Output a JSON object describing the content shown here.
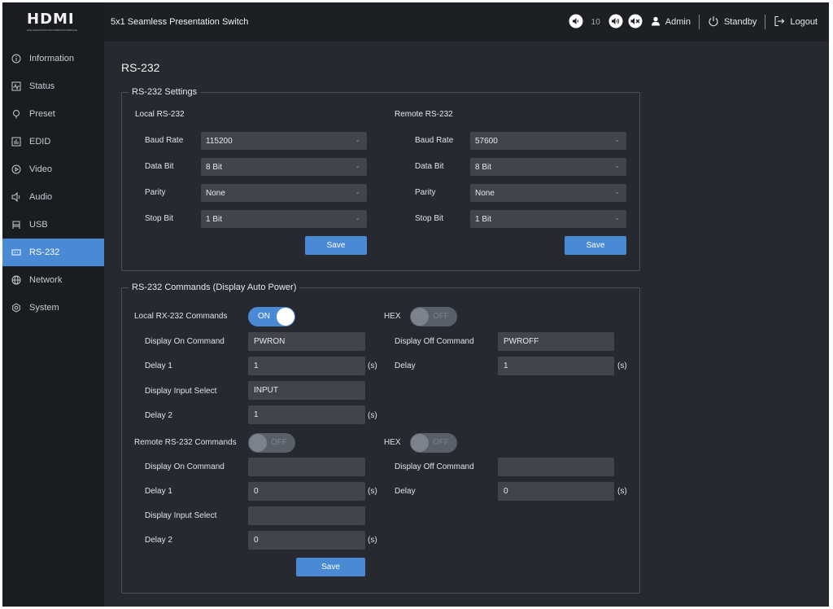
{
  "logo": {
    "text": "HDMI",
    "subtitle": "HIGH-DEFINITION MULTIMEDIA INTERFACE"
  },
  "header": {
    "title": "5x1 Seamless Presentation Switch",
    "volume_value": "10",
    "admin_label": "Admin",
    "standby_label": "Standby",
    "logout_label": "Logout"
  },
  "sidebar": {
    "items": [
      {
        "label": "Information",
        "icon": "info-icon"
      },
      {
        "label": "Status",
        "icon": "status-icon"
      },
      {
        "label": "Preset",
        "icon": "preset-icon"
      },
      {
        "label": "EDID",
        "icon": "edid-icon"
      },
      {
        "label": "Video",
        "icon": "video-icon"
      },
      {
        "label": "Audio",
        "icon": "audio-icon"
      },
      {
        "label": "USB",
        "icon": "usb-icon"
      },
      {
        "label": "RS-232",
        "icon": "rs232-icon",
        "active": true
      },
      {
        "label": "Network",
        "icon": "network-icon"
      },
      {
        "label": "System",
        "icon": "system-icon"
      }
    ]
  },
  "page": {
    "title": "RS-232"
  },
  "settings": {
    "legend": "RS-232 Settings",
    "local": {
      "title": "Local RS-232",
      "baud_label": "Baud Rate",
      "baud_value": "115200",
      "data_label": "Data Bit",
      "data_value": "8 Bit",
      "parity_label": "Parity",
      "parity_value": "None",
      "stop_label": "Stop Bit",
      "stop_value": "1 Bit",
      "save_label": "Save"
    },
    "remote": {
      "title": "Remote RS-232",
      "baud_label": "Baud Rate",
      "baud_value": "57600",
      "data_label": "Data Bit",
      "data_value": "8 Bit",
      "parity_label": "Parity",
      "parity_value": "None",
      "stop_label": "Stop Bit",
      "stop_value": "1 Bit",
      "save_label": "Save"
    }
  },
  "commands": {
    "legend": "RS-232 Commands (Display Auto Power)",
    "local": {
      "label": "Local RX-232 Commands",
      "toggle_text": "ON",
      "hex_label": "HEX",
      "hex_toggle_text": "OFF",
      "on_cmd_label": "Display On Command",
      "on_cmd_value": "PWRON",
      "off_cmd_label": "Display Off Command",
      "off_cmd_value": "PWROFF",
      "delay1_label": "Delay 1",
      "delay1_value": "1",
      "delay_label": "Delay",
      "delay_value": "1",
      "input_sel_label": "Display Input Select",
      "input_sel_value": "INPUT",
      "delay2_label": "Delay 2",
      "delay2_value": "1",
      "unit": "(s)"
    },
    "remote": {
      "label": "Remote RS-232 Commands",
      "toggle_text": "OFF",
      "hex_label": "HEX",
      "hex_toggle_text": "OFF",
      "on_cmd_label": "Display On Command",
      "on_cmd_value": "",
      "off_cmd_label": "Display Off Command",
      "off_cmd_value": "",
      "delay1_label": "Delay 1",
      "delay1_value": "0",
      "delay_label": "Delay",
      "delay_value": "0",
      "input_sel_label": "Display Input Select",
      "input_sel_value": "",
      "delay2_label": "Delay 2",
      "delay2_value": "0",
      "unit": "(s)"
    },
    "save_label": "Save"
  }
}
